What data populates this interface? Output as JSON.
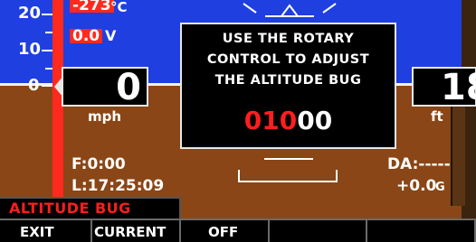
{
  "scale": {
    "labels": [
      "20",
      "10",
      "0"
    ]
  },
  "readouts": {
    "temperature": {
      "value": "-273",
      "unit": "°C"
    },
    "voltage": {
      "value": "0.0",
      "unit": "V"
    }
  },
  "airspeed": {
    "value": "0",
    "unit": "mph"
  },
  "altitude": {
    "value": "18",
    "unit": "ft"
  },
  "flight_time": "F:0:00",
  "local_time": "L:17:25:09",
  "density_altitude": "DA:-----",
  "g_load": {
    "value": "+0.0",
    "unit": "G"
  },
  "dialog": {
    "line1": "USE THE ROTARY",
    "line2": "CONTROL TO ADJUST",
    "line3": "THE ALTITUDE BUG",
    "value_red": "010",
    "value_white": "00"
  },
  "mode_title": "ALTITUDE BUG",
  "softkeys": [
    "EXIT",
    "CURRENT",
    "OFF",
    "",
    ""
  ],
  "colors": {
    "sky": "#1f3fe0",
    "ground": "#8a4616",
    "warning_red": "#ff2a1e"
  }
}
